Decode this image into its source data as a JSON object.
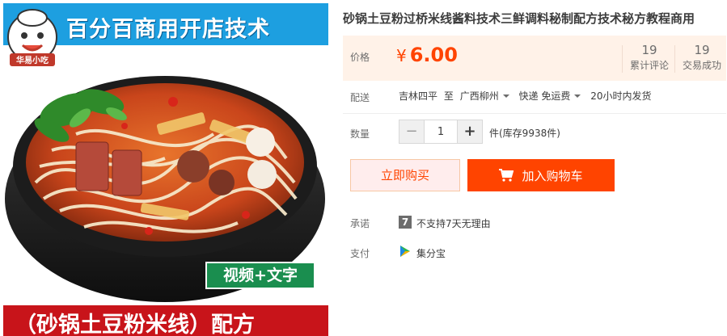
{
  "product_image": {
    "banner_text": "百分百商用开店技术",
    "mascot_text": "华易小吃",
    "video_badge": "视频+文字",
    "bottom_text": "（砂锅土豆粉米线）配方"
  },
  "title": "砂锅土豆粉过桥米线酱料技术三鲜调料秘制配方技术秘方教程商用",
  "price": {
    "label": "价格",
    "currency": "¥",
    "amount": "6.00",
    "color": "#ff4400"
  },
  "stats": [
    {
      "number": "19",
      "label": "累计评论"
    },
    {
      "number": "19",
      "label": "交易成功"
    }
  ],
  "delivery": {
    "label": "配送",
    "from": "吉林四平",
    "to_word": "至",
    "destination": "广西柳州",
    "method": "快递 免运费",
    "ship_time": "20小时内发货"
  },
  "quantity": {
    "label": "数量",
    "minus": "−",
    "value": "1",
    "plus": "+",
    "stock_text": "件(库存9938件)"
  },
  "buttons": {
    "buy_now": "立即购买",
    "add_to_cart": "加入购物车",
    "accent": "#ff4400",
    "buy_now_bg": "#ffeded"
  },
  "promise": {
    "label": "承诺",
    "icon_glyph": "7",
    "icon_name": "seven-day-icon",
    "text": "不支持7天无理由"
  },
  "payment": {
    "label": "支付",
    "icon_name": "jifenbao-icon",
    "text": "集分宝"
  }
}
